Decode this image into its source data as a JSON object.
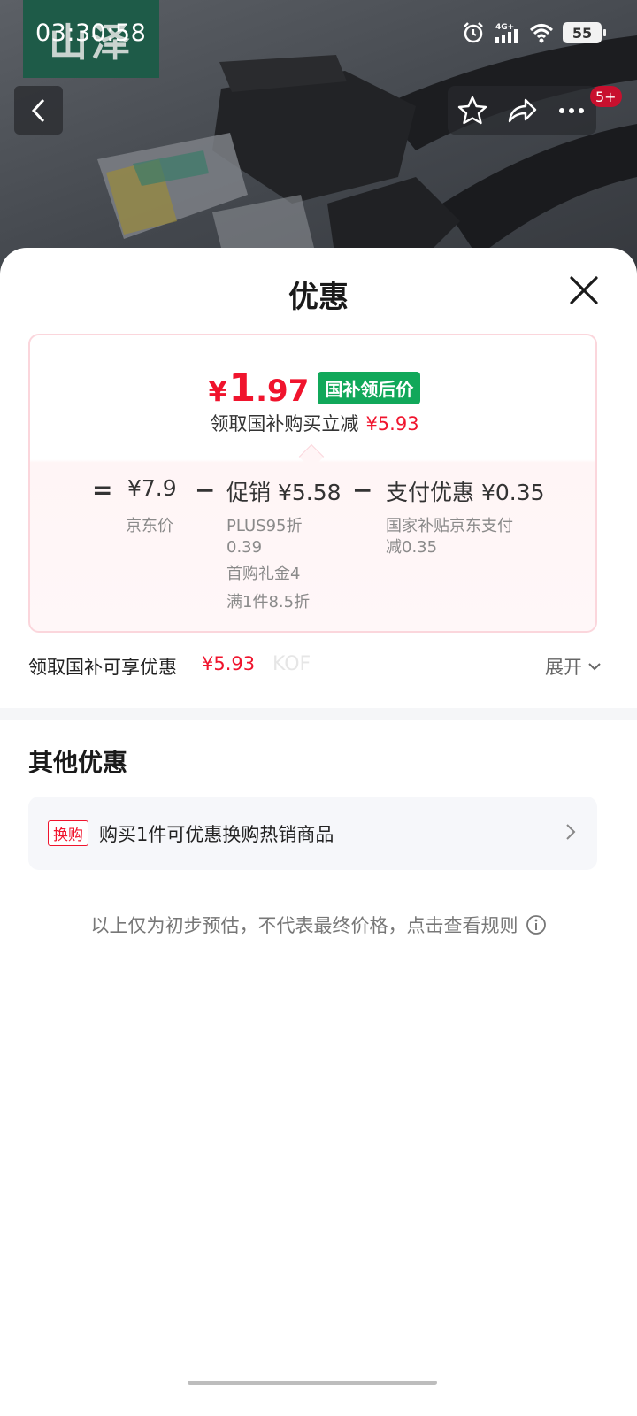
{
  "status_bar": {
    "time": "03:30:58",
    "network": "4G+",
    "battery": "55"
  },
  "product": {
    "brand_logo_text": "山泽",
    "notification_badge": "5+"
  },
  "sheet": {
    "title": "优惠",
    "price_card": {
      "currency": "¥",
      "final_price_int": "1",
      "final_price_dec": ".97",
      "final_tag": "国补领后价",
      "saving_label": "领取国补购买立减",
      "saving_amount": "¥5.93",
      "breakdown": {
        "equals": "=",
        "minus1": "−",
        "minus2": "−",
        "jd_price": "¥7.9",
        "jd_price_label": "京东价",
        "promo": "促销 ¥5.58",
        "promo_note_1": "PLUS95折",
        "promo_note_2": "0.39",
        "promo_note_3": "首购礼金4",
        "promo_note_4": "满1件8.5折",
        "payment": "支付优惠 ¥0.35",
        "payment_note_1": "国家补贴京东支付",
        "payment_note_2": "减0.35"
      }
    },
    "gov_subsidy": {
      "label": "领取国补可享优惠",
      "amount": "¥5.93",
      "watermark": "KOF",
      "expand_label": "展开"
    },
    "other_offers": {
      "title": "其他优惠",
      "items": [
        {
          "tag": "换购",
          "text": "购买1件可优惠换购热销商品"
        }
      ]
    },
    "disclaimer": "以上仅为初步预估，不代表最终价格，点击查看规则"
  },
  "colors": {
    "price_red": "#f0142d",
    "tag_green": "#11a85a",
    "card_border": "#fbd6dc"
  }
}
